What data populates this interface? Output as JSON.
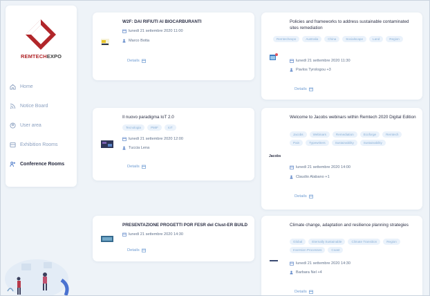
{
  "brand": {
    "part1": "REMTECH",
    "part2": "EXPO",
    "logo_color": "#b1262a"
  },
  "nav": [
    {
      "label": "Home",
      "icon": "home-icon"
    },
    {
      "label": "Notice Board",
      "icon": "rss-icon"
    },
    {
      "label": "User area",
      "icon": "user-icon"
    },
    {
      "label": "Exhibition Rooms",
      "icon": "room-icon"
    },
    {
      "label": "Conference Rooms",
      "icon": "conference-icon",
      "active": true
    }
  ],
  "cards": [
    {
      "title": "W2F: DAI RIFIUTI AI BIOCARBURANTI",
      "tags": [],
      "date": "lunedì 21 settembre 2020 11:00",
      "speaker": "Marco Botta",
      "details": "Details"
    },
    {
      "title": "Policies and frameworks to address sustainable contaminated sites remediation",
      "tags": [
        "Remtechexpo",
        "Australia",
        "China",
        "Socialscape",
        "Land",
        "Region"
      ],
      "date": "lunedì 21 settembre 2020 11:30",
      "speaker": "Pavlos Tyrologou +3",
      "details": "Details"
    },
    {
      "title": "Il nuovo paradigma IoT 2.0",
      "tags": [
        "Tecnologia",
        "PMIF",
        "IoT"
      ],
      "date": "lunedì 21 settembre 2020 12:00",
      "speaker": "Tuccia Lena",
      "details": "Details"
    },
    {
      "title": "Welcome to Jacobs webinars within Remtech 2020 Digital Edition",
      "tags": [
        "Jacobs",
        "Webinars",
        "Remediation",
        "Ecoforge",
        "Remtech",
        "Pain",
        "Typewriters",
        "Sustainability",
        "Sustainability"
      ],
      "date": "lunedì 21 settembre 2020 14:00",
      "speaker": "Claudio Alabano +1",
      "details": "Details"
    },
    {
      "title": "PRESENTAZIONE PROGETTI POR FESR del Clust-ER BUILD",
      "tags": [],
      "date": "lunedì 21 settembre 2020 14:30",
      "speaker": "",
      "details": "Details"
    },
    {
      "title": "Climate change, adaptation and resilience planning strategies",
      "tags": [
        "Global",
        "Eternally Sustainable",
        "Climate Transition",
        "Region",
        "Inversion Processes",
        "Coast"
      ],
      "date": "lunedì 21 settembre 2020 14:30",
      "speaker": "Barbara Nel +4",
      "details": "Details"
    }
  ],
  "jacobs_logo": "Jacobs",
  "colors": {
    "accent": "#6c9ad2",
    "tag_bg": "#eaf2fb",
    "background": "#eef3f8"
  }
}
